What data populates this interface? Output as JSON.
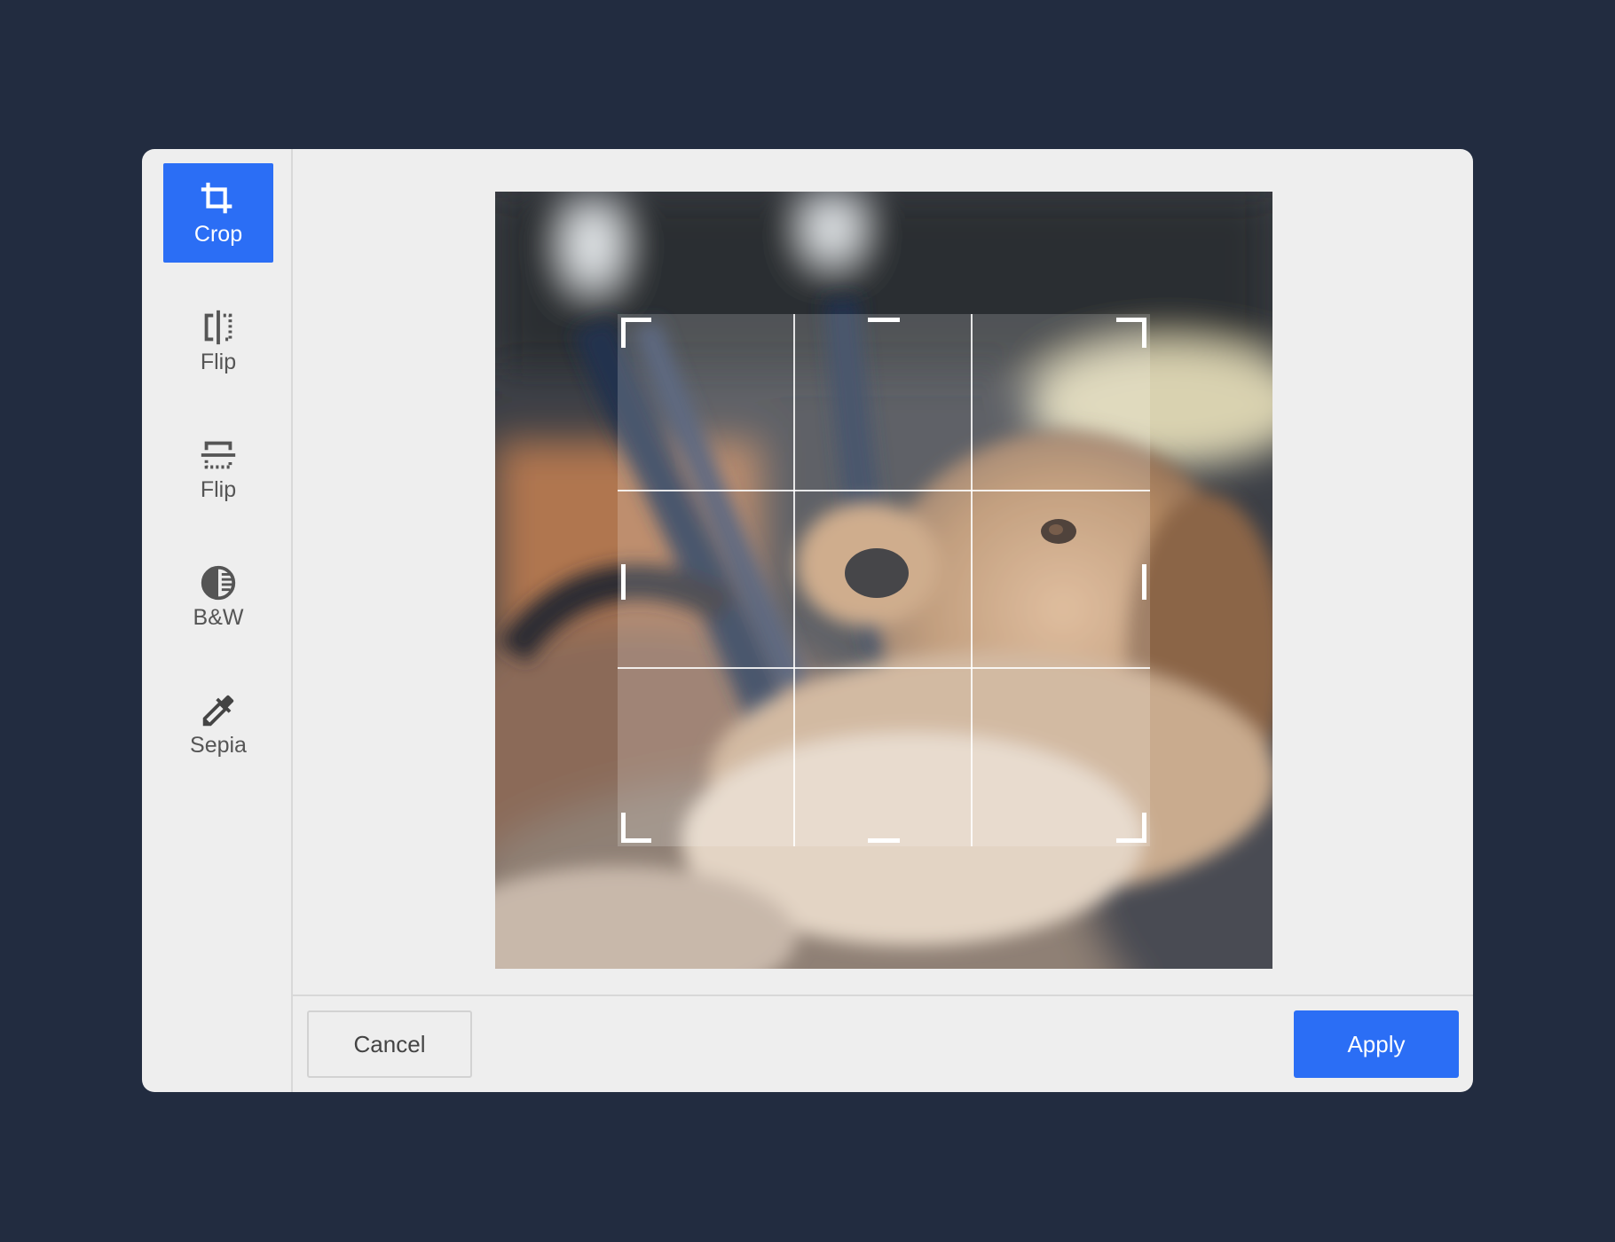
{
  "sidebar": {
    "tools": [
      {
        "label": "Crop",
        "icon": "crop-icon",
        "active": true
      },
      {
        "label": "Flip",
        "icon": "flip-horizontal-icon",
        "active": false
      },
      {
        "label": "Flip",
        "icon": "flip-vertical-icon",
        "active": false
      },
      {
        "label": "B&W",
        "icon": "contrast-icon",
        "active": false
      },
      {
        "label": "Sepia",
        "icon": "eyedropper-icon",
        "active": false
      }
    ]
  },
  "footer": {
    "cancel_label": "Cancel",
    "apply_label": "Apply"
  },
  "colors": {
    "accent": "#2b6ef5",
    "backdrop": "#222c40",
    "panel": "#eeeeee"
  }
}
